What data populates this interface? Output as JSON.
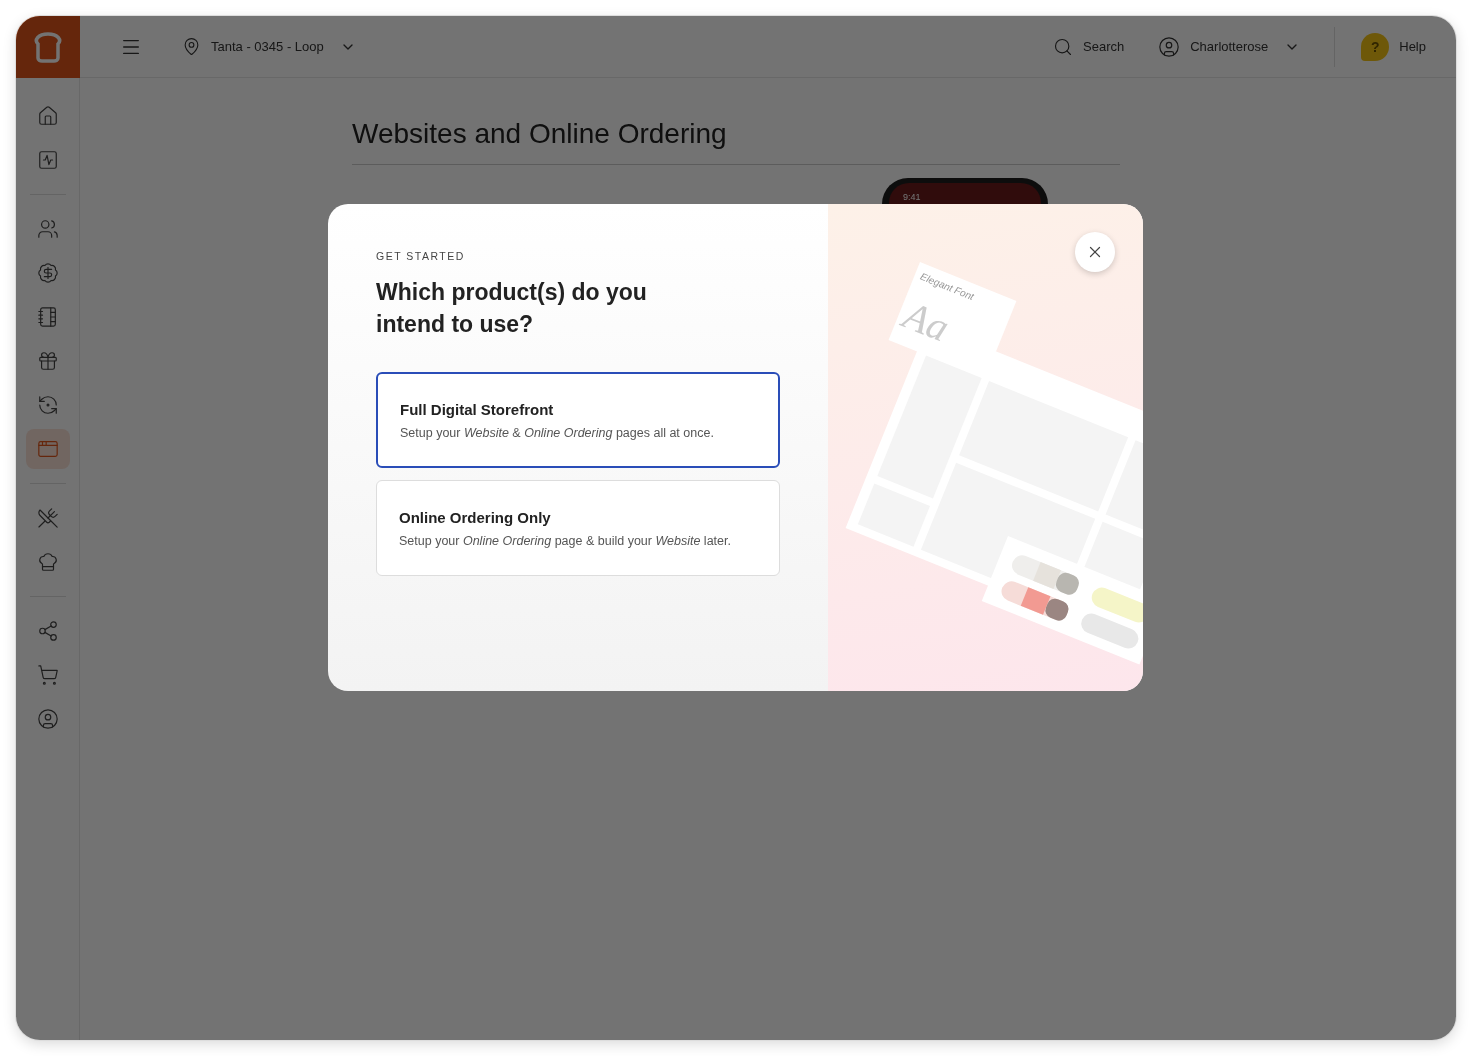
{
  "topbar": {
    "location": "Tanta - 0345 -  Loop",
    "search": "Search",
    "user": "Charlotterose",
    "help_badge": "?",
    "help": "Help"
  },
  "sidebar": {
    "groups": [
      [
        {
          "selected": false
        },
        {
          "selected": false
        }
      ],
      [
        {
          "selected": false
        },
        {
          "selected": false
        },
        {
          "selected": false
        },
        {
          "selected": false
        },
        {
          "selected": false
        },
        {
          "selected": true
        }
      ],
      [
        {
          "selected": false
        },
        {
          "selected": false
        }
      ],
      [
        {
          "selected": false
        },
        {
          "selected": false
        },
        {
          "selected": false
        }
      ]
    ]
  },
  "page": {
    "title": "Websites and Online Ordering",
    "phone_time": "9:41"
  },
  "modal": {
    "eyebrow": "GET STARTED",
    "title": "Which product(s) do you intend to use?",
    "options": [
      {
        "title": "Full Digital Storefront",
        "description": "Setup your *Website* & *Online Ordering* pages all at once.",
        "selected": true
      },
      {
        "title": "Online Ordering Only",
        "description": "Setup your *Online Ordering* page & build your *Website* later.",
        "selected": false
      }
    ],
    "illustration": {
      "font_label": "Elegant Font",
      "font_sample": "Aa"
    }
  }
}
